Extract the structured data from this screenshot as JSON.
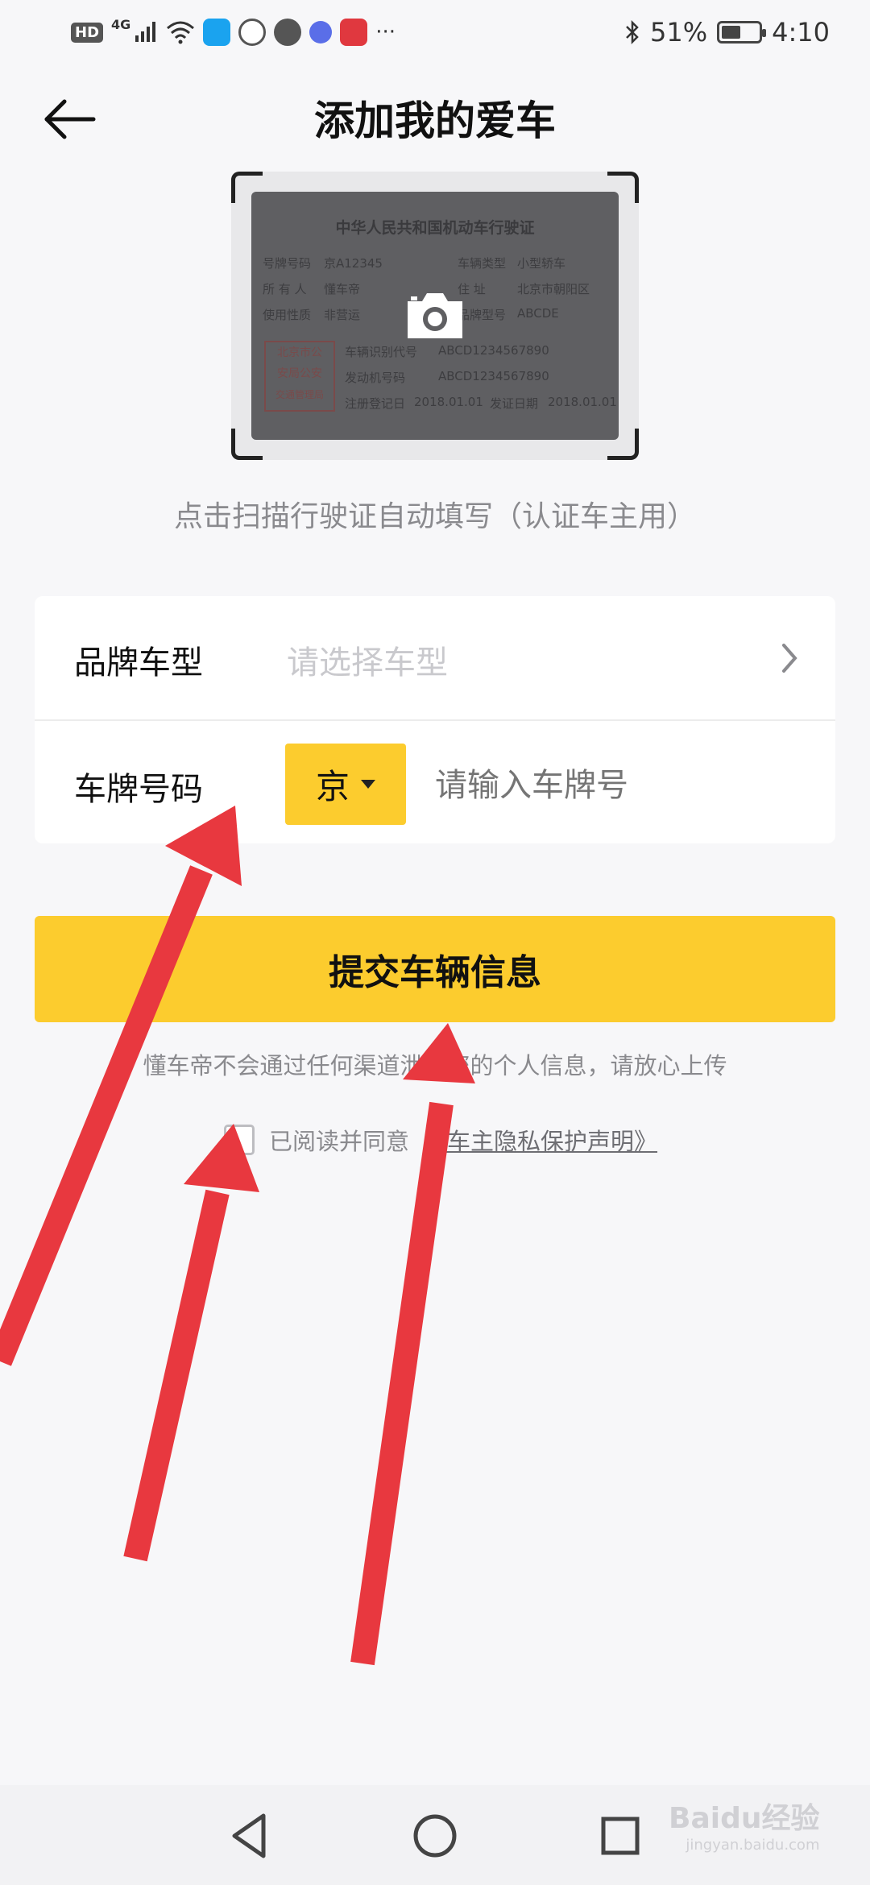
{
  "status_bar": {
    "left_badges": [
      "HD",
      "4G"
    ],
    "battery_percent": "51%",
    "battery_level": 0.51,
    "time": "4:10",
    "more": "···",
    "icons": [
      "signal-icon",
      "wifi-icon",
      "search-app-icon",
      "browser-app-icon",
      "hand-app-icon",
      "music-app-icon",
      "book-app-icon",
      "bluetooth-icon",
      "battery-icon"
    ]
  },
  "header": {
    "title": "添加我的爱车",
    "back_icon": "arrow-left-icon"
  },
  "license": {
    "title": "中华人民共和国机动车行驶证",
    "fields": [
      {
        "label": "号牌号码",
        "value": "京A12345"
      },
      {
        "label": "车辆类型",
        "value": "小型轿车"
      },
      {
        "label": "所 有 人",
        "value": "懂车帝"
      },
      {
        "label": "住    址",
        "value": "北京市朝阳区"
      },
      {
        "label": "使用性质",
        "value": "非营运"
      },
      {
        "label": "品牌型号",
        "value": "ABCDE"
      },
      {
        "label": "车辆识别代号",
        "value": "ABCD1234567890"
      },
      {
        "label": "发动机号码",
        "value": "ABCD1234567890"
      },
      {
        "label": "注册登记日",
        "value": "2018.01.01"
      },
      {
        "label": "发证日期",
        "value": "2018.01.01"
      }
    ],
    "stamp": [
      "北京市公",
      "安局公安",
      "交通管理局"
    ],
    "camera_icon": "camera-icon"
  },
  "scan_hint": "点击扫描行驶证自动填写（认证车主用）",
  "form": {
    "model_label": "品牌车型",
    "model_placeholder": "请选择车型",
    "plate_label": "车牌号码",
    "province": "京",
    "plate_placeholder": "请输入车牌号"
  },
  "submit_label": "提交车辆信息",
  "privacy_note": "懂车帝不会通过任何渠道泄露您的个人信息，请放心上传",
  "agree_text": "已阅读并同意",
  "agree_link": "《车主隐私保护声明》",
  "watermark": {
    "brand": "Baidu经验",
    "site": "jingyan.baidu.com"
  },
  "colors": {
    "accent": "#fccc2e",
    "annotation_arrow": "#e8383f"
  }
}
